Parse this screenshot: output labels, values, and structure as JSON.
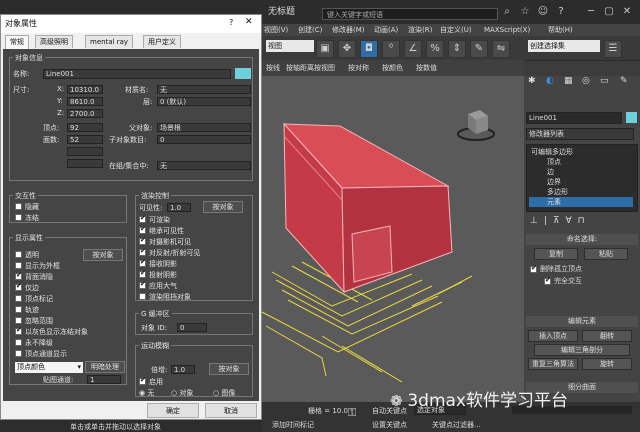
{
  "app": {
    "name": "无标题",
    "search_placeholder": "键入关键字或短语",
    "menus": [
      "编辑(E)",
      "工具(T)",
      "组(G)",
      "视图(V)",
      "创建(C)",
      "修改器(M)",
      "动画(A)",
      "图形编辑器(D)",
      "渲染(R)",
      "自定义(U)",
      "MAXScript(X)",
      "帮助(H)"
    ],
    "view_select": "视图",
    "selection_set": "创建选择集",
    "toolbar2": [
      "按线",
      "按轴距离",
      "按视图",
      "按对称",
      "按颜色",
      "按数值"
    ]
  },
  "dialog": {
    "title": "对象属性",
    "help": "?",
    "close": "✕",
    "tabs": [
      "常规",
      "高级照明",
      "mental ray",
      "用户定义"
    ],
    "object_info": {
      "title": "对象信息",
      "name_label": "名称:",
      "name_value": "Line001",
      "dims_label": "尺寸:",
      "x_label": "X:",
      "x_value": "10310.0",
      "y_label": "Y:",
      "y_value": "8610.0",
      "z_label": "Z:",
      "z_value": "2700.0",
      "material_label": "材质名:",
      "material_value": "无",
      "layer_label": "层:",
      "layer_value": "0 (默认)",
      "vertices_label": "顶点:",
      "vertices_value": "92",
      "faces_label": "面数:",
      "faces_value": "52",
      "parent_label": "父对象:",
      "parent_value": "场景根",
      "children_label": "子对象数目:",
      "children_value": "0",
      "group_label": "在组/集合中:",
      "group_value": "无"
    },
    "interactivity": {
      "title": "交互性",
      "hide": "隐藏",
      "freeze": "冻结"
    },
    "display": {
      "title": "显示属性",
      "by_object": "按对象",
      "items": [
        "透明",
        "显示为外框",
        "背面消隐",
        "仅边",
        "顶点标记",
        "轨迹",
        "忽略范围",
        "以灰色显示冻结对象",
        "永不降级",
        "顶点通道显示"
      ],
      "vertex_color": "顶点颜色",
      "shaded": "明暗处理",
      "map_channel_label": "贴图通道:",
      "map_channel_value": "1"
    },
    "render": {
      "title": "渲染控制",
      "visibility_label": "可见性:",
      "visibility_value": "1.0",
      "by_object": "按对象",
      "items": [
        "可渲染",
        "继承可见性",
        "对摄影机可见",
        "对反射/折射可见",
        "接收阴影",
        "投射阴影",
        "应用大气",
        "渲染阻挡对象"
      ]
    },
    "gbuffer": {
      "title": "G 缓冲区",
      "id_label": "对象 ID:",
      "id_value": "0"
    },
    "motion_blur": {
      "title": "运动模糊",
      "multiplier_label": "倍增:",
      "multiplier_value": "1.0",
      "by_object": "按对象",
      "enable": "启用",
      "none": "无",
      "object": "对象",
      "image": "图像"
    },
    "ok": "确定",
    "cancel": "取消"
  },
  "command_panel": {
    "object_name": "Line001",
    "modifier_list": "修改器列表",
    "stack": [
      "可编辑多边形",
      "顶点",
      "边",
      "边界",
      "多边形",
      "元素"
    ],
    "selection_title": "命名选择:",
    "copy": "复制",
    "paste": "粘贴",
    "delete_isolated": "删除孤立顶点",
    "full_interactivity": "完全交互",
    "edit_elements": "编辑元素",
    "insert_vertex": "插入顶点",
    "flip": "翻转",
    "edit_triangulation": "编辑三角剖分",
    "retriangulate": "重复三角算法",
    "turn": "旋转",
    "subdivide": "细分曲面"
  },
  "status": {
    "grid": "栅格 = 10.0",
    "auto_key": "自动关键点",
    "set_key": "设置关键点",
    "selected": "选定对象",
    "key_filter": "关键点过滤器...",
    "add_time_tag": "添加时间标记",
    "prompt": "单击或单击并拖动以选择对象",
    "frame": "0"
  },
  "watermark": "3dmax软件学习平台"
}
